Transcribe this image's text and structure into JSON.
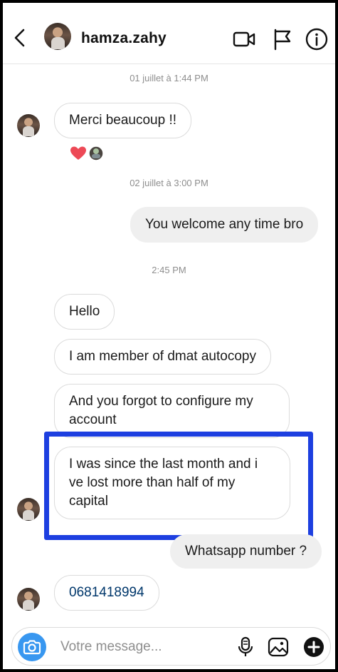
{
  "header": {
    "username": "hamza.zahy"
  },
  "messages": [
    {
      "kind": "timestamp",
      "text": "01 juillet à 1:44 PM"
    },
    {
      "kind": "in",
      "text": "Merci beaucoup !!"
    },
    {
      "kind": "timestamp",
      "text": "02 juillet à 3:00 PM"
    },
    {
      "kind": "out",
      "text": "You welcome any time bro"
    },
    {
      "kind": "timestamp",
      "text": "2:45 PM"
    },
    {
      "kind": "in",
      "text": "Hello"
    },
    {
      "kind": "in",
      "text": "I am member of dmat autocopy"
    },
    {
      "kind": "in",
      "text": "And you forgot to configure my account"
    },
    {
      "kind": "in",
      "text": "I was since the last month and i ve lost more than half of my capital"
    },
    {
      "kind": "out",
      "text": "Whatsapp number ?"
    },
    {
      "kind": "in",
      "text": "0681418994"
    }
  ],
  "reactions": [
    "heart-icon",
    "avatar-reaction"
  ],
  "composer": {
    "placeholder": "Votre message..."
  },
  "colors": {
    "highlight": "#1d3fe0",
    "phone_link": "#00376b",
    "camera": "#3897f0",
    "heart": "#ed4956"
  }
}
